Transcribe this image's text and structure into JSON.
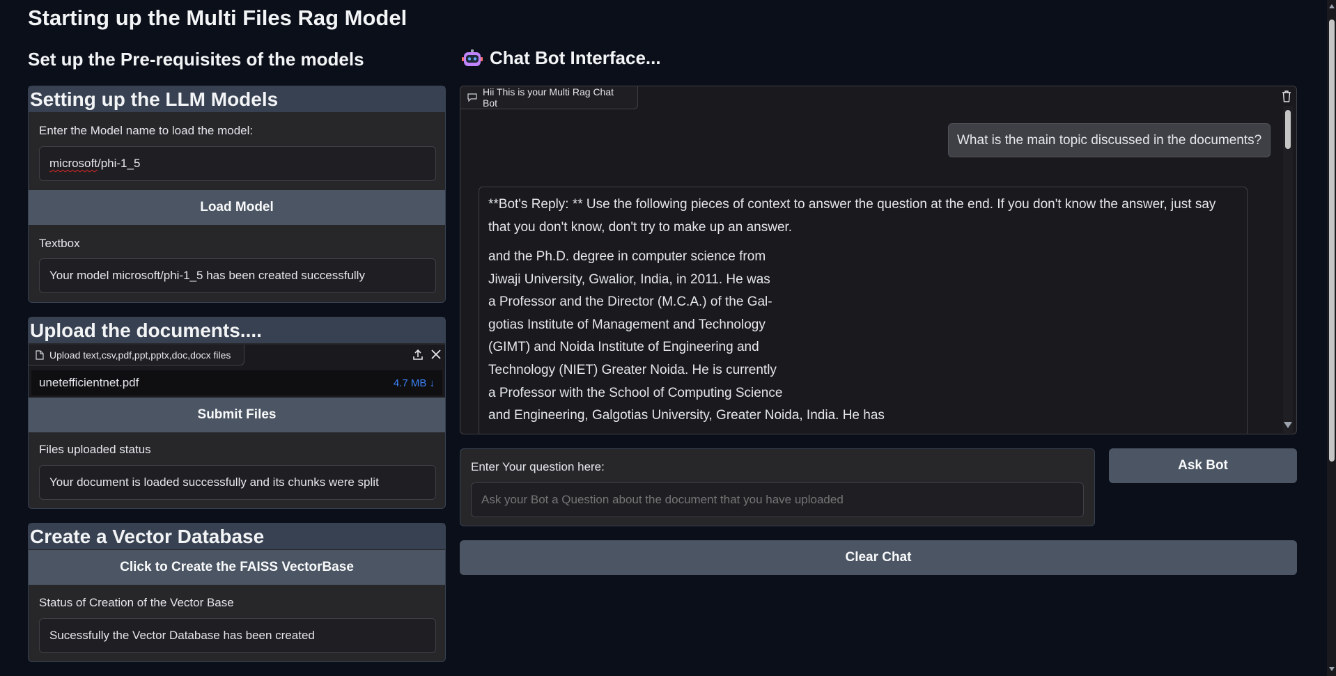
{
  "page": {
    "title": "Starting up the Multi Files Rag Model"
  },
  "left": {
    "heading": "Set up the Pre-requisites of the models",
    "llm": {
      "title": "Setting up the LLM Models",
      "model_label": "Enter the Model name to load the model:",
      "model_value_part1": "microsoft",
      "model_value_part2": "/phi-1_5",
      "load_button": "Load Model",
      "status_label": "Textbox",
      "status_value": "Your model microsoft/phi-1_5 has been created successfully"
    },
    "upload": {
      "title": "Upload the documents....",
      "tag": "Upload text,csv,pdf,ppt,pptx,doc,docx files",
      "file_name": "unetefficientnet.pdf",
      "file_size": "4.7 MB ↓",
      "submit_button": "Submit Files",
      "status_label": "Files uploaded status",
      "status_value": "Your document is loaded successfully and its chunks were split"
    },
    "vector": {
      "title": "Create a Vector Database",
      "create_button": "Click to Create the FAISS VectorBase",
      "status_label": "Status of Creation of the Vector Base",
      "status_value": "Sucessfully the Vector Database has been created"
    }
  },
  "right": {
    "heading": "Chat Bot Interface...",
    "chat_tag": "Hii This is your Multi Rag Chat Bot",
    "user_message": "What is the main topic discussed in the documents?",
    "bot_intro": "**Bot's Reply: ** Use the following pieces of context to answer the question at the end. If you don't know the answer, just say that you don't know, don't try to make up an answer.",
    "bot_lines": [
      "and the Ph.D. degree in computer science from",
      "Jiwaji University, Gwalior, India, in 2011. He was",
      "a Professor and the Director (M.C.A.) of the Gal-",
      "gotias Institute of Management and Technology",
      "(GIMT) and Noida Institute of Engineering and",
      "Technology (NIET) Greater Noida. He is currently",
      "a Professor with the School of Computing Science",
      "and Engineering, Galgotias University, Greater Noida, India. He has"
    ],
    "question_label": "Enter Your question here:",
    "question_placeholder": "Ask your Bot a Question about the document that you have uploaded",
    "ask_button": "Ask Bot",
    "clear_button": "Clear Chat"
  },
  "colors": {
    "background": "#0b0f19",
    "button": "#4b5563",
    "file_size_link": "#3b82f6"
  }
}
